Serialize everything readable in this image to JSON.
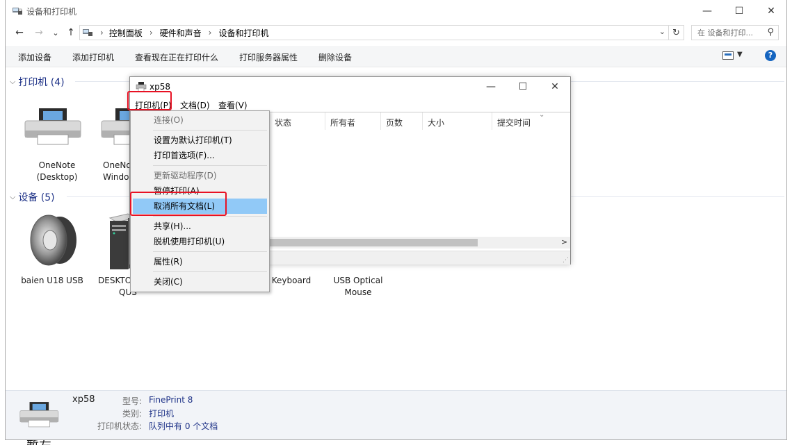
{
  "window": {
    "title": "设备和打印机",
    "minimize": "—",
    "maximize": "☐",
    "close": "✕"
  },
  "nav": {
    "back": "←",
    "forward": "→",
    "recent": "⌄",
    "up": "↑",
    "breadcrumb": [
      "控制面板",
      "硬件和声音",
      "设备和打印机"
    ],
    "refresh": "↻",
    "search_placeholder": "在 设备和打印...",
    "search_icon": "⚲"
  },
  "toolbar": {
    "items": [
      "添加设备",
      "添加打印机",
      "查看现在正在打印什么",
      "打印服务器属性",
      "删除设备"
    ],
    "help": "?"
  },
  "printers_group": {
    "label": "打印机 (4)"
  },
  "printers": [
    {
      "line1": "OneNote",
      "line2": "(Desktop)"
    },
    {
      "line1": "OneNo",
      "line2": "Windo"
    }
  ],
  "devices_group": {
    "label": "设备 (5)"
  },
  "devices": [
    {
      "line1": "baien U18  USB",
      "line2": ""
    },
    {
      "line1": "DESKTO",
      "line2": "QUS"
    },
    {
      "line1": "Keyboard",
      "line2": ""
    },
    {
      "line1": "USB Optical",
      "line2": "Mouse"
    }
  ],
  "details": {
    "name": "xp58",
    "model_label": "型号:",
    "model_value": "FinePrint 8",
    "category_label": "类别:",
    "category_value": "打印机",
    "status_label": "打印机状态:",
    "status_value": "队列中有 0 个文档"
  },
  "clipped_bottom_text": "暂左",
  "queue": {
    "title": "xp58",
    "menus": [
      "打印机(P)",
      "文档(D)",
      "查看(V)"
    ],
    "columns": [
      "状态",
      "所有者",
      "页数",
      "大小",
      "提交时间"
    ],
    "scroll_right": ">"
  },
  "menu": {
    "items": [
      {
        "label": "连接(O)",
        "disabled": true
      },
      {
        "label": "设置为默认打印机(T)",
        "disabled": false
      },
      {
        "label": "打印首选项(F)...",
        "disabled": false
      },
      {
        "label": "更新驱动程序(D)",
        "disabled": true
      },
      {
        "label": "暂停打印(A)",
        "disabled": false
      },
      {
        "label": "取消所有文档(L)",
        "disabled": false,
        "highlighted": true
      },
      {
        "label": "共享(H)...",
        "disabled": false
      },
      {
        "label": "脱机使用打印机(U)",
        "disabled": false
      },
      {
        "label": "属性(R)",
        "disabled": false
      },
      {
        "label": "关闭(C)",
        "disabled": false
      }
    ]
  },
  "colors": {
    "accent": "#1e3287",
    "highlight": "#91c9f7",
    "annotation_red": "#e81123"
  }
}
